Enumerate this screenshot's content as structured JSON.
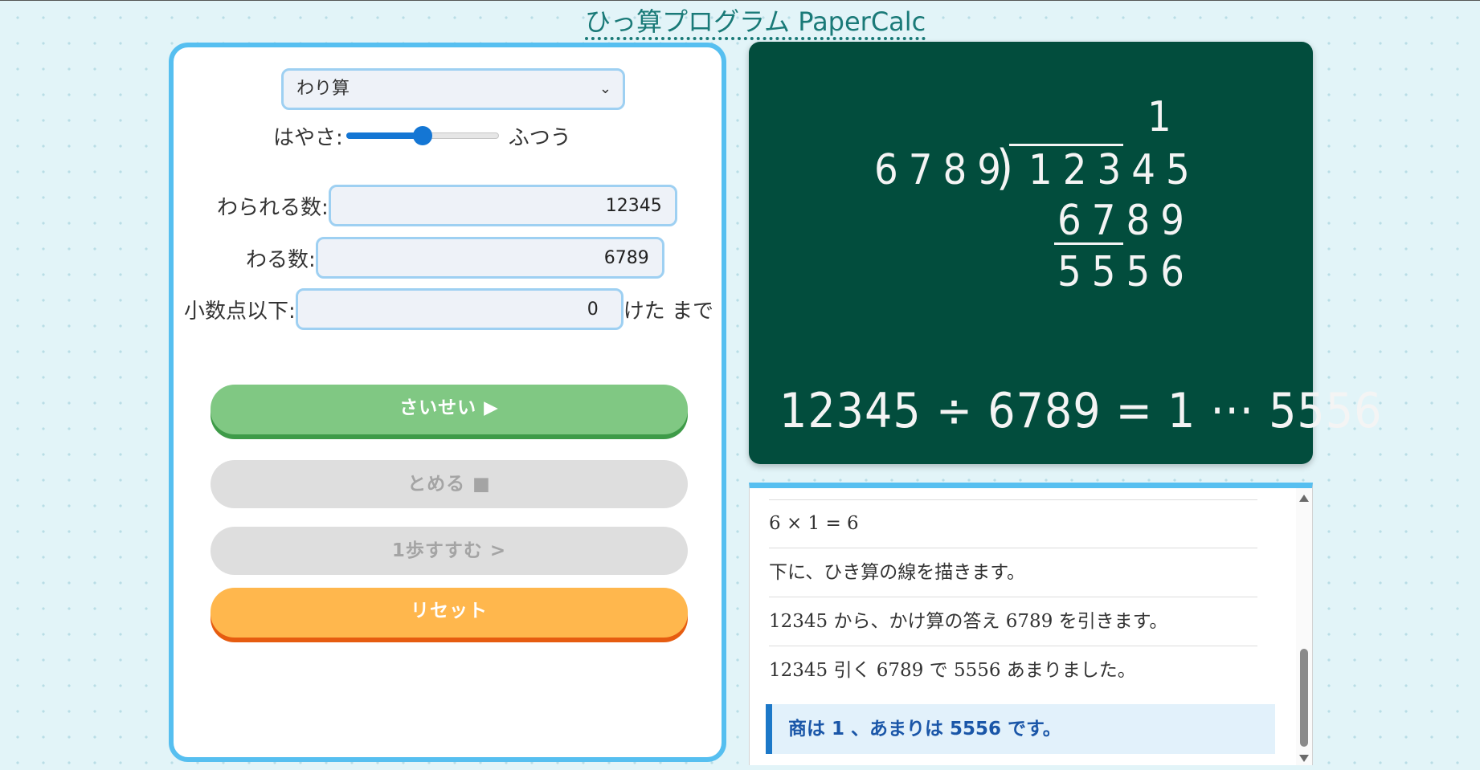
{
  "app": {
    "title": "ひっ算プログラム PaperCalc"
  },
  "controls": {
    "operation": {
      "selected": "わり算"
    },
    "speed": {
      "label": "はやさ:",
      "value_label": "ふつう",
      "level": 0.5
    },
    "dividend": {
      "label": "わられる数:",
      "value": "12345"
    },
    "divisor": {
      "label": "わる数:",
      "value": "6789"
    },
    "decimals": {
      "label": "小数点以下:",
      "value": "0",
      "suffix": "けた まで"
    }
  },
  "buttons": {
    "play": "さいせい ▶",
    "stop": "とめる ■",
    "step": "1歩すすむ >",
    "reset": "リセット"
  },
  "board": {
    "quotient": "1",
    "divisor": "6789",
    "dividend": "12345",
    "product": "6789",
    "remainder": "5556",
    "result": "12345 ÷ 6789 = 1 ··· 5556"
  },
  "log": {
    "items": [
      "6 × 1 = 6",
      "下に、ひき算の線を描きます。",
      "12345 から、かけ算の答え 6789 を引きます。",
      "12345 引く 6789 で 5556 あまりました。"
    ],
    "summary": "商は 1 、あまりは 5556 です。"
  },
  "colors": {
    "panel_border": "#56bff0",
    "board": "#024d3d",
    "play": "#80c883",
    "reset": "#ffb74d",
    "summary_accent": "#1c78c8"
  }
}
